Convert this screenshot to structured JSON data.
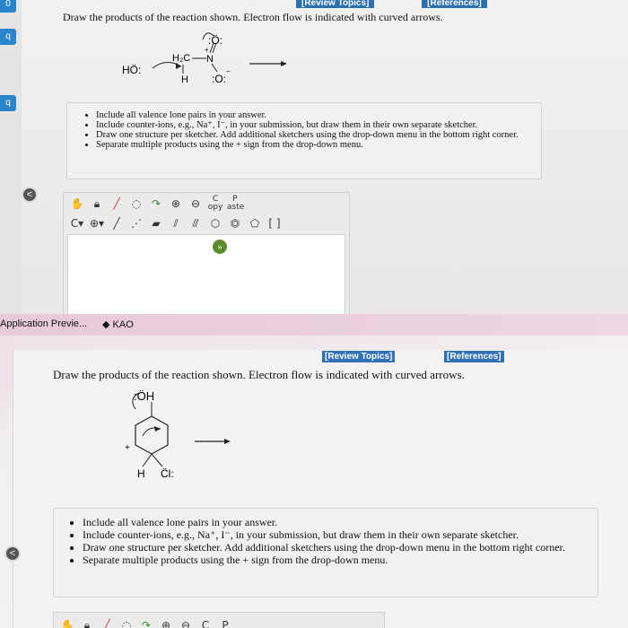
{
  "top": {
    "rail_tabs": [
      "0",
      "q",
      "q"
    ],
    "links": {
      "review": "[Review Topics]",
      "references": "[References]"
    },
    "question": "Draw the products of the reaction shown. Electron flow is indicated with curved arrows.",
    "molecule": {
      "ho": "HÖ:",
      "h2c": "H₂C",
      "n": "N",
      "h": "H",
      "o_top": ":Ö:",
      "o_bot": ":O:",
      "plus": "+",
      "minus": "−"
    },
    "instructions": [
      "Include all valence lone pairs in your answer.",
      "Include counter-ions, e.g., Na⁺, I⁻, in your submission, but draw them in their own separate sketcher.",
      "Draw one structure per sketcher. Add additional sketchers using the drop-down menu in the bottom right corner.",
      "Separate multiple products using the + sign from the drop-down menu."
    ],
    "collapse_glyph": "<",
    "toolbar": {
      "row1": [
        "hand-icon",
        "lock-icon",
        "eraser-icon",
        "lasso-icon",
        "redo-icon",
        "zoom-in-icon",
        "zoom-out-icon",
        "copy-icon",
        "paste-icon"
      ],
      "copy_label": "C",
      "copy_sub": "opy",
      "paste_label": "P",
      "paste_sub": "aste",
      "element": "C",
      "charge": "⊕",
      "bracket": "[ ]±"
    },
    "go_label": "»"
  },
  "bottom": {
    "app_title": "Application Previe...",
    "app_kao": "KAO",
    "links": {
      "review": "[Review Topics]",
      "references": "[References]"
    },
    "question": "Draw the products of the reaction shown. Electron flow is indicated with curved arrows.",
    "molecule": {
      "oh": ":ÖH",
      "h": "H",
      "cl": "C̈l:",
      "plus": "+"
    },
    "instructions": [
      "Include all valence lone pairs in your answer.",
      "Include counter-ions, e.g., Na⁺, I⁻, in your submission, but draw them in their own separate sketcher.",
      "Draw one structure per sketcher. Add additional sketchers using the drop-down menu in the bottom right corner.",
      "Separate multiple products using the + sign from the drop-down menu."
    ],
    "collapse_glyph": "<",
    "toolbar": {
      "copy_label": "C",
      "paste_label": "P"
    }
  },
  "colors": {
    "accent": "#2a6fb0",
    "go": "#5b8c2a",
    "app_bar": "#e8c9d8"
  }
}
